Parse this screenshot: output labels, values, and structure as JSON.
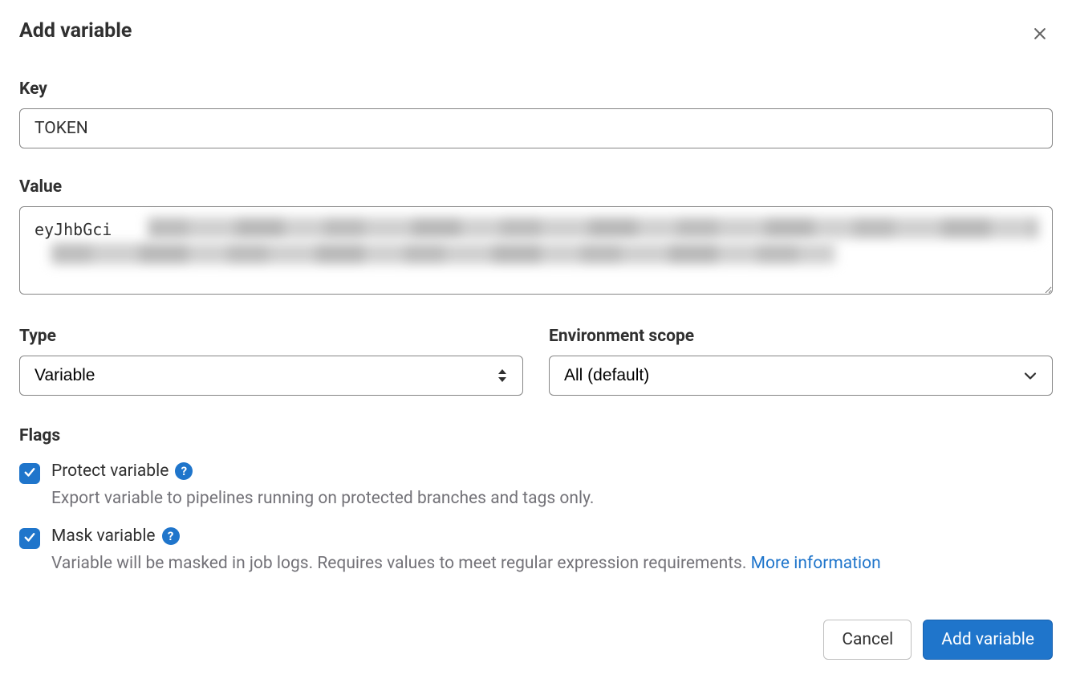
{
  "title": "Add variable",
  "key": {
    "label": "Key",
    "value": "TOKEN"
  },
  "value": {
    "label": "Value",
    "text": "eyJhbGci"
  },
  "type": {
    "label": "Type",
    "selected": "Variable"
  },
  "scope": {
    "label": "Environment scope",
    "selected": "All (default)"
  },
  "flags": {
    "label": "Flags",
    "protect": {
      "checked": true,
      "label": "Protect variable",
      "desc": "Export variable to pipelines running on protected branches and tags only."
    },
    "mask": {
      "checked": true,
      "label": "Mask variable",
      "desc": "Variable will be masked in job logs. Requires values to meet regular expression requirements. ",
      "link": "More information"
    }
  },
  "footer": {
    "cancel": "Cancel",
    "submit": "Add variable"
  }
}
